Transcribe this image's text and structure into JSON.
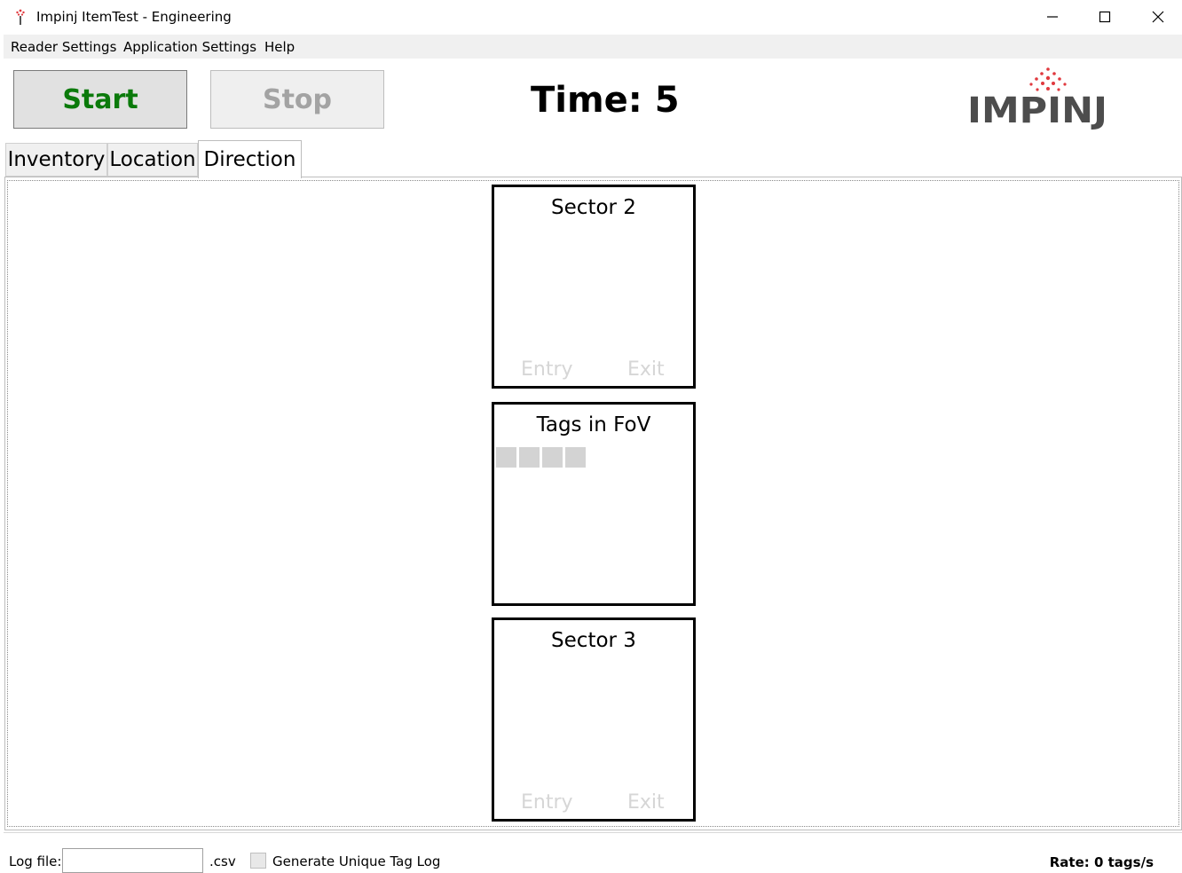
{
  "window": {
    "title": "Impinj ItemTest - Engineering"
  },
  "menu": {
    "items": [
      {
        "label": "Reader Settings"
      },
      {
        "label": "Application Settings"
      },
      {
        "label": "Help"
      }
    ]
  },
  "controls": {
    "start_label": "Start",
    "stop_label": "Stop",
    "time_label": "Time: 5",
    "logo_text": "IMPINJ"
  },
  "tabs": [
    {
      "label": "Inventory",
      "active": false
    },
    {
      "label": "Location",
      "active": false
    },
    {
      "label": "Direction",
      "active": true
    }
  ],
  "direction": {
    "sector2": {
      "title": "Sector 2",
      "entry": "Entry",
      "exit": "Exit"
    },
    "fov": {
      "title": "Tags in FoV"
    },
    "sector3": {
      "title": "Sector 3",
      "entry": "Entry",
      "exit": "Exit"
    }
  },
  "bottom": {
    "log_label": "Log file:",
    "log_value": "",
    "csv_label": ".csv",
    "unique_log_label": "Generate Unique Tag Log",
    "unique_log_checked": false,
    "rate_label": "Rate: 0 tags/s"
  },
  "colors": {
    "start_text": "#0b7a0b",
    "stop_text": "#a3a3a3",
    "logo_dots": "#e0393e",
    "logo_text": "#4d4d4d"
  },
  "icons": {
    "app": "impinj-app-icon",
    "minimize": "minimize-icon",
    "maximize": "maximize-icon",
    "close": "close-icon"
  }
}
